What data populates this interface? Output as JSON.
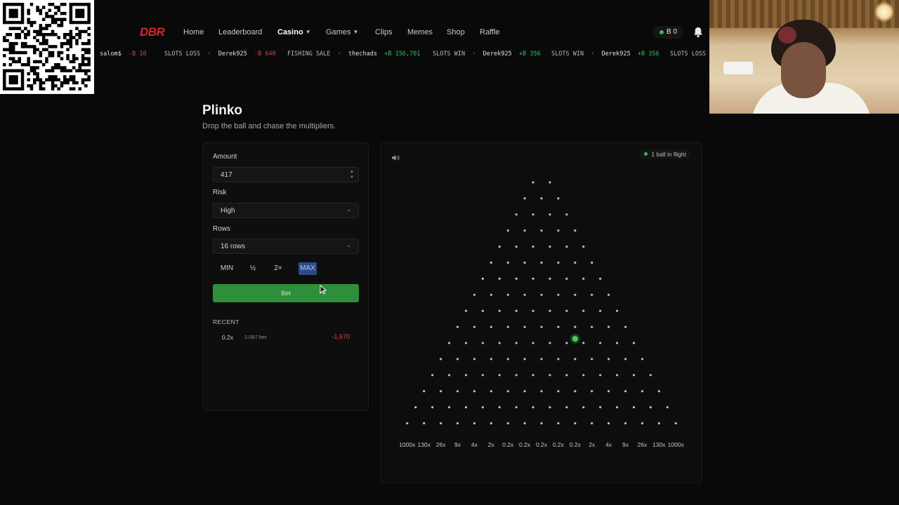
{
  "nav": {
    "logo": "DBR",
    "items": [
      {
        "label": "Home",
        "active": false,
        "dropdown": false
      },
      {
        "label": "Leaderboard",
        "active": false,
        "dropdown": false
      },
      {
        "label": "Casino",
        "active": true,
        "dropdown": true
      },
      {
        "label": "Games",
        "active": false,
        "dropdown": true
      },
      {
        "label": "Clips",
        "active": false,
        "dropdown": false
      },
      {
        "label": "Memes",
        "active": false,
        "dropdown": false
      },
      {
        "label": "Shop",
        "active": false,
        "dropdown": false
      },
      {
        "label": "Raffle",
        "active": false,
        "dropdown": false
      }
    ],
    "balance": "B 0",
    "bell_icon": "bell-icon"
  },
  "ticker": [
    {
      "game": "",
      "user": "salom$",
      "amount": "-B 10",
      "sign": "neg"
    },
    {
      "game": "SLOTS LOSS",
      "user": "Derek925",
      "amount": "-B 640",
      "sign": "neg"
    },
    {
      "game": "FISHING SALE",
      "user": "thechads",
      "amount": "+B 156,701",
      "sign": "pos"
    },
    {
      "game": "SLOTS WIN",
      "user": "Derek925",
      "amount": "+B 356",
      "sign": "pos"
    },
    {
      "game": "SLOTS WIN",
      "user": "Derek925",
      "amount": "+B 356",
      "sign": "pos"
    },
    {
      "game": "SLOTS LOSS",
      "user": "",
      "amount": "",
      "sign": "neg"
    }
  ],
  "page": {
    "title": "Plinko",
    "subtitle": "Drop the ball and chase the multipliers."
  },
  "controls": {
    "amount_label": "Amount",
    "amount_value": "417",
    "risk_label": "Risk",
    "risk_value": "High",
    "rows_label": "Rows",
    "rows_value": "16 rows",
    "quick": {
      "min": "MIN",
      "half": "½",
      "double": "2×",
      "max": "MAX"
    },
    "bet_label": "Bet"
  },
  "recent": {
    "heading": "RECENT",
    "rows": [
      {
        "multiplier": "0.2x",
        "bet": "2,087 bet",
        "profit": "-1,670"
      }
    ]
  },
  "board": {
    "status": "1 ball in flight",
    "rows": 16,
    "multipliers": [
      "1000x",
      "130x",
      "26x",
      "9x",
      "4x",
      "2x",
      "0.2x",
      "0.2x",
      "0.2x",
      "0.2x",
      "0.2x",
      "2x",
      "4x",
      "9x",
      "26x",
      "130x",
      "1000x"
    ],
    "ball": {
      "row": 10,
      "peg": 7
    },
    "colors": {
      "peg": "#bdbdbd",
      "ball": "#3fd257",
      "accent_green": "#2e8f3a",
      "loss_red": "#d9434b"
    }
  }
}
